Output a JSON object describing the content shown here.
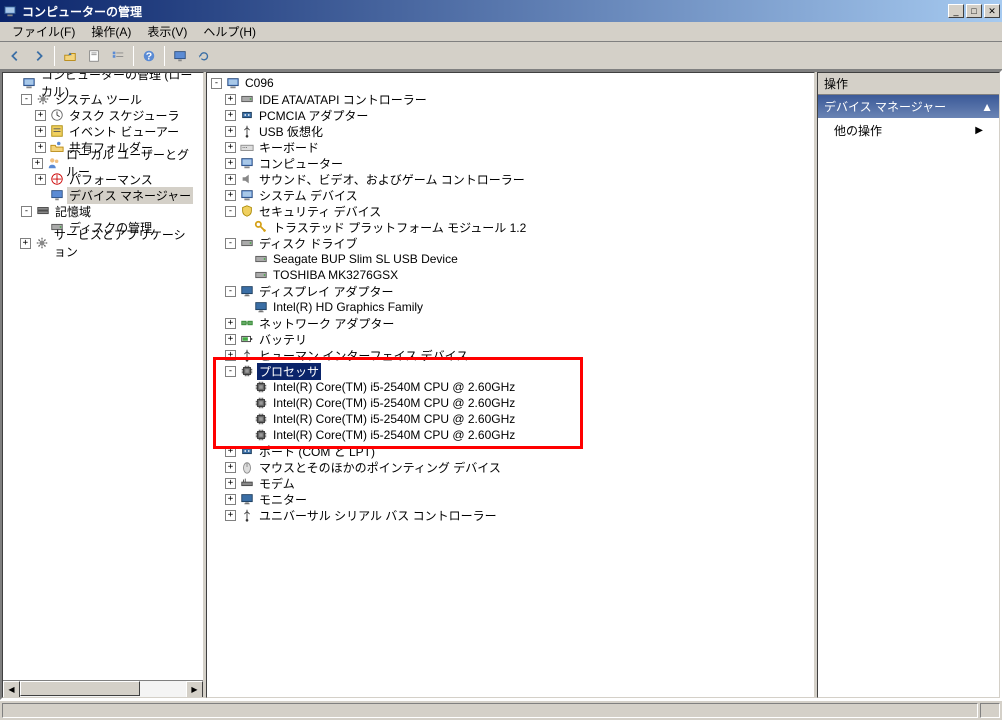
{
  "window": {
    "title": "コンピューターの管理"
  },
  "menu": {
    "file": "ファイル(F)",
    "action": "操作(A)",
    "view": "表示(V)",
    "help": "ヘルプ(H)"
  },
  "leftpanel": {
    "header": "コンピューターの管理 (ローカル)",
    "tree": {
      "root": "コンピューターの管理 (ローカル)",
      "systemtools": "システム ツール",
      "taskscheduler": "タスク スケジューラ",
      "eventviewer": "イベント ビューアー",
      "sharedfolders": "共有フォルダー",
      "localusers": "ローカル ユーザーとグルー",
      "performance": "パフォーマンス",
      "devicemanager": "デバイス マネージャー",
      "storage": "記憶域",
      "diskmgmt": "ディスクの管理",
      "services": "サービスとアプリケーション"
    }
  },
  "centerpanel": {
    "root": "C096",
    "items": {
      "ide": "IDE ATA/ATAPI コントローラー",
      "pcmcia": "PCMCIA アダプター",
      "usbvirt": "USB 仮想化",
      "keyboard": "キーボード",
      "computer": "コンピューター",
      "sound": "サウンド、ビデオ、およびゲーム コントローラー",
      "sysdev": "システム デバイス",
      "security": "セキュリティ デバイス",
      "tpm": "トラステッド プラットフォーム モジュール 1.2",
      "diskdrive": "ディスク ドライブ",
      "seagate": "Seagate BUP Slim SL USB Device",
      "toshiba": "TOSHIBA MK3276GSX",
      "display": "ディスプレイ アダプター",
      "intelhd": "Intel(R) HD Graphics Family",
      "network": "ネットワーク アダプター",
      "battery": "バッテリ",
      "hid": "ヒューマン インターフェイス デバイス",
      "processor": "プロセッサ",
      "cpu1": "Intel(R) Core(TM) i5-2540M CPU @ 2.60GHz",
      "cpu2": "Intel(R) Core(TM) i5-2540M CPU @ 2.60GHz",
      "cpu3": "Intel(R) Core(TM) i5-2540M CPU @ 2.60GHz",
      "cpu4": "Intel(R) Core(TM) i5-2540M CPU @ 2.60GHz",
      "ports": "ポート (COM と LPT)",
      "mouse": "マウスとそのほかのポインティング デバイス",
      "modem": "モデム",
      "monitor": "モニター",
      "usbctrl": "ユニバーサル シリアル バス コントローラー"
    }
  },
  "rightpanel": {
    "header": "操作",
    "section": "デバイス マネージャー",
    "moreactions": "他の操作"
  }
}
